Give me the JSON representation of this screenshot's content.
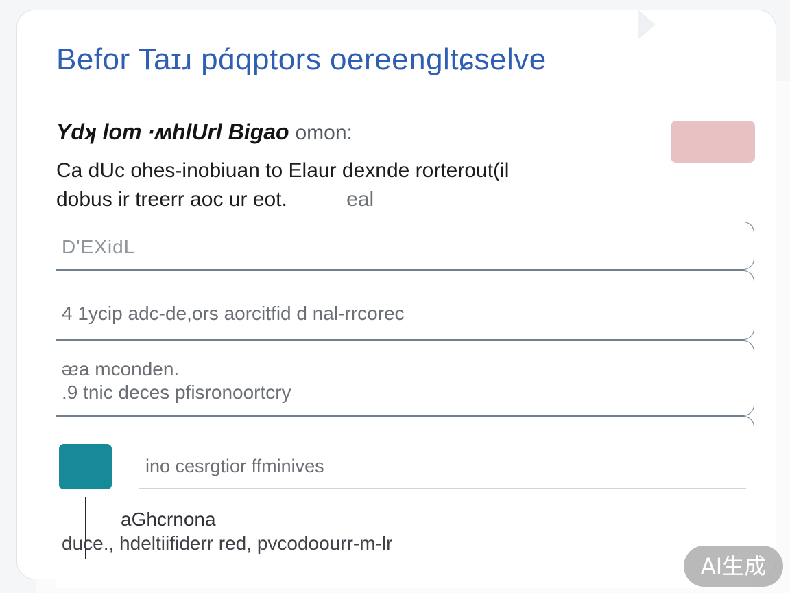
{
  "title": "Befor Taɪɹ pɑ́qptors oereengltɕselve",
  "section": {
    "heading_bold": "Ydʞ lom ·ʍhlUrl Bigao",
    "heading_light": "omon:",
    "description_line1": "Ca dUc ohes-inobiuan    to Elaur dexnde rorterout(il",
    "description_line2": "dobus ir treerr aoc ur eot.",
    "description_line2_faded": "eal"
  },
  "colors": {
    "title": "#2f5fb3",
    "tag_button": "#e8c2c2",
    "swatch": "#168a98",
    "field_border": "#6f7f8d"
  },
  "fields": [
    {
      "placeholder": "D'EXidL"
    },
    {
      "value": "4 1ycip adc-de,ors aorcitfid d nal-rrcorec"
    },
    {
      "line1": "ᴂa   mconden.",
      "line2": ".9  tnic  deces pfisronoortcry"
    }
  ],
  "color_field": {
    "name_value": "ino cesrgtior ffminives",
    "subtitle": "aGhcrnona",
    "description": "duce., hdeltiifiderr red, pvcodoourr-m-lr"
  },
  "badge": "AI生成"
}
